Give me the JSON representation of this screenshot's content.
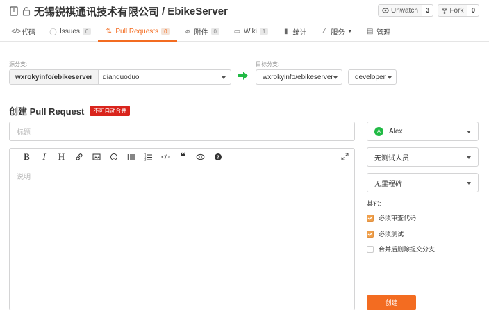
{
  "repo": {
    "owner": "无锡锐祺通讯技术有限公司",
    "separator": "/",
    "name": "EbikeServer"
  },
  "actions": {
    "watch": {
      "label": "Unwatch",
      "count": "3"
    },
    "fork": {
      "label": "Fork",
      "count": "0"
    }
  },
  "tabs": [
    {
      "label": "代码",
      "icon": "code-icon"
    },
    {
      "label": "Issues",
      "badge": "0",
      "icon": "issue-icon"
    },
    {
      "label": "Pull Requests",
      "badge": "0",
      "icon": "pull-request-icon"
    },
    {
      "label": "附件",
      "badge": "0",
      "icon": "attachment-icon"
    },
    {
      "label": "Wiki",
      "badge": "1",
      "icon": "book-icon"
    },
    {
      "label": "统计",
      "icon": "bar-chart-icon"
    },
    {
      "label": "服务",
      "icon": "pulse-icon"
    },
    {
      "label": "管理",
      "icon": "settings-icon"
    }
  ],
  "branches": {
    "source_label": "源分支:",
    "target_label": "目标分支:",
    "source_owner": "wxrokyinfo/ebikeserver",
    "source_branch": "dianduoduo",
    "target_repo": "wxrokyinfo/ebikeserver",
    "target_branch": "developer"
  },
  "form": {
    "heading": "创建 Pull Request",
    "merge_warning": "不可自动合并",
    "title_placeholder": "标题",
    "body_placeholder": "说明"
  },
  "sidebar": {
    "assignee": "Alex",
    "assignee_initial": "A",
    "tester": "无测试人员",
    "milestone": "无里程碑",
    "other_label": "其它:",
    "options": [
      {
        "label": "必须审查代码",
        "checked": true
      },
      {
        "label": "必须测试",
        "checked": true
      },
      {
        "label": "合并后删除提交分支",
        "checked": false
      }
    ],
    "submit_label": "创建"
  },
  "colors": {
    "accent": "#f36c21",
    "warning": "#d9241c",
    "arrow": "#21ba45"
  }
}
